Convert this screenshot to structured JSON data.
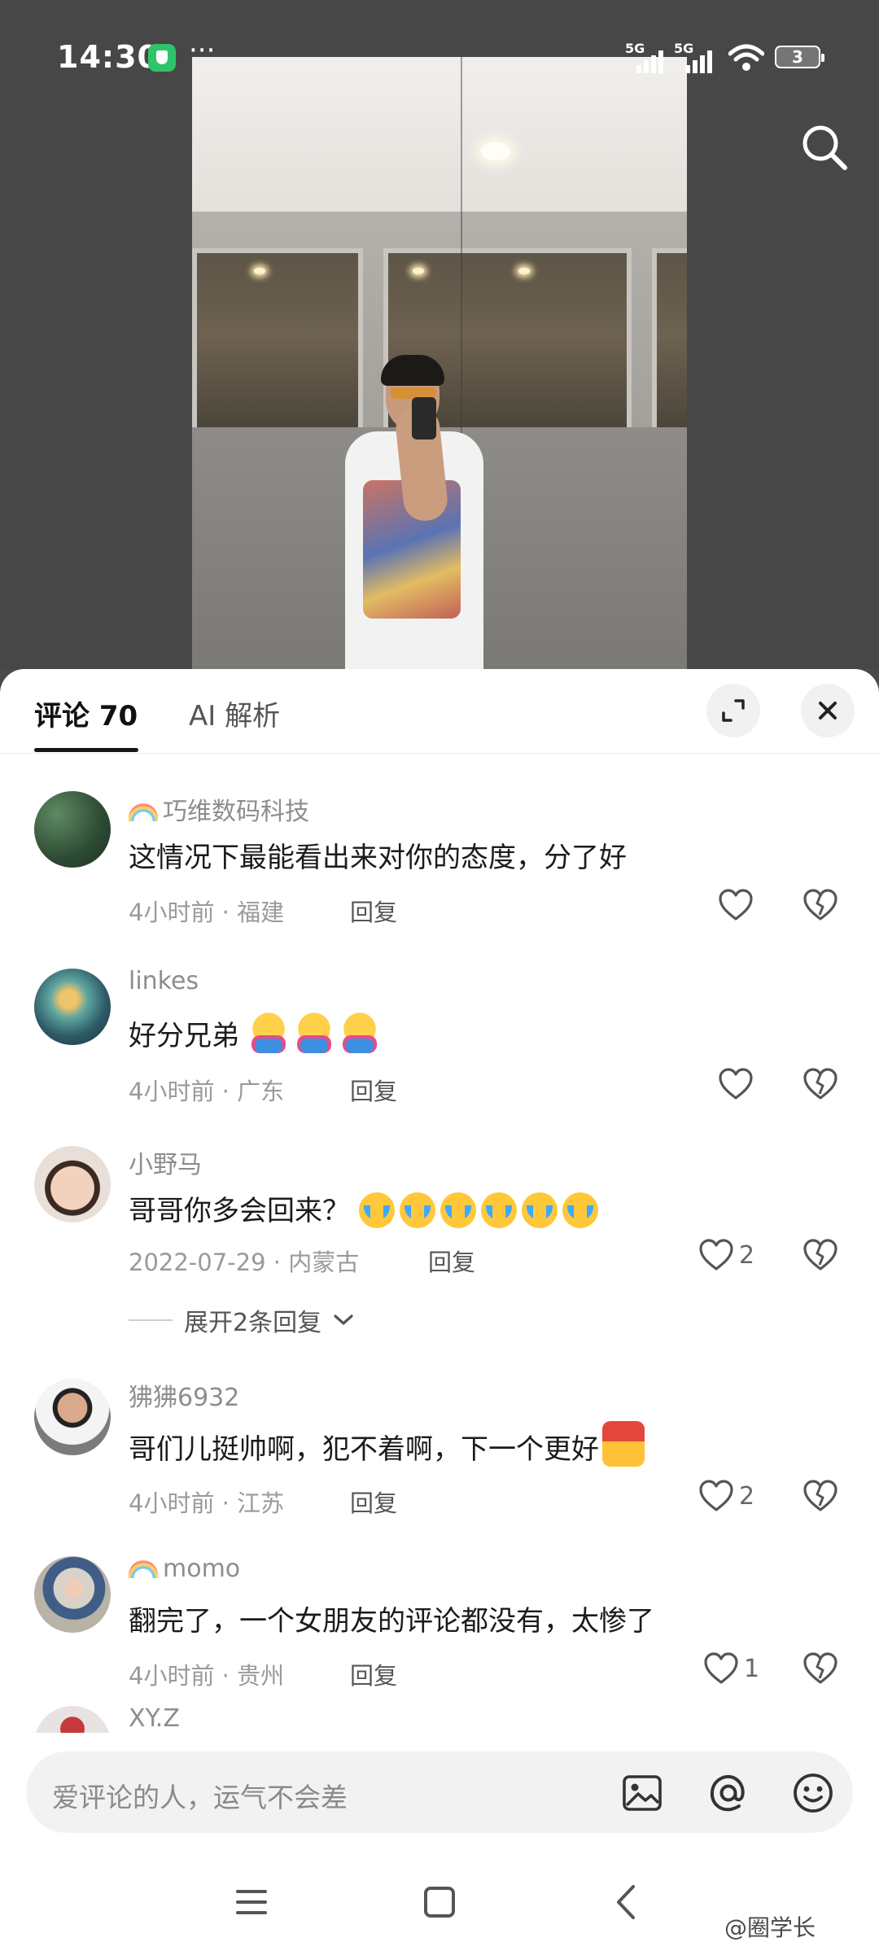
{
  "status_bar": {
    "time": "14:30",
    "dots": "···",
    "signal_1_label": "5G",
    "signal_2_label": "5G",
    "battery": "3"
  },
  "header": {
    "tabs": [
      {
        "label": "评论 70",
        "active": true
      },
      {
        "label": "AI 解析",
        "active": false
      }
    ]
  },
  "comments": [
    {
      "username": "巧维数码科技",
      "badge": "rainbow",
      "text": "这情况下最能看出来对你的态度，分了好",
      "emojis": [],
      "time": "4小时前",
      "location": "福建",
      "reply_label": "回复",
      "likes": ""
    },
    {
      "username": "linkes",
      "badge": "",
      "text": "好分兄弟",
      "emojis": [
        "hug-emoji",
        "hug-emoji",
        "hug-emoji"
      ],
      "time": "4小时前",
      "location": "广东",
      "reply_label": "回复",
      "likes": ""
    },
    {
      "username": "小野马",
      "badge": "",
      "text": "哥哥你多会回来？",
      "emojis": [
        "crying-emoji",
        "crying-emoji",
        "crying-emoji",
        "crying-emoji",
        "crying-emoji",
        "crying-emoji"
      ],
      "time": "2022-07-29",
      "location": "内蒙古",
      "reply_label": "回复",
      "likes": "2",
      "expand_replies": "展开2条回复"
    },
    {
      "username": "狒狒6932",
      "badge": "",
      "text": "哥们儿挺帅啊，犯不着啊，下一个更好",
      "emojis": [
        "thumbs-up-emoji"
      ],
      "time": "4小时前",
      "location": "江苏",
      "reply_label": "回复",
      "likes": "2"
    },
    {
      "username": "momo",
      "badge": "rainbow",
      "text": "翻完了，一个女朋友的评论都没有，太惨了",
      "emojis": [],
      "time": "4小时前",
      "location": "贵州",
      "reply_label": "回复",
      "likes": "1"
    },
    {
      "username": "XY.Z",
      "badge": "",
      "text": "",
      "emojis": [],
      "time": "",
      "location": "",
      "reply_label": "",
      "likes": ""
    }
  ],
  "meta_separator": " · ",
  "input": {
    "placeholder": "爱评论的人，运气不会差"
  },
  "watermark": "@圈学长",
  "icons": [
    "shield-icon",
    "search-icon",
    "expand-icon",
    "close-icon",
    "heart-icon",
    "broken-heart-icon",
    "chevron-down-icon",
    "image-icon",
    "at-icon",
    "emoji-icon",
    "menu-icon",
    "home-icon",
    "back-icon"
  ],
  "colors": {
    "sheet_bg": "#ffffff",
    "username": "#8d8d8d",
    "meta": "#9a9a9a",
    "tab_underline": "#161616",
    "shield": "#2fc46a"
  }
}
